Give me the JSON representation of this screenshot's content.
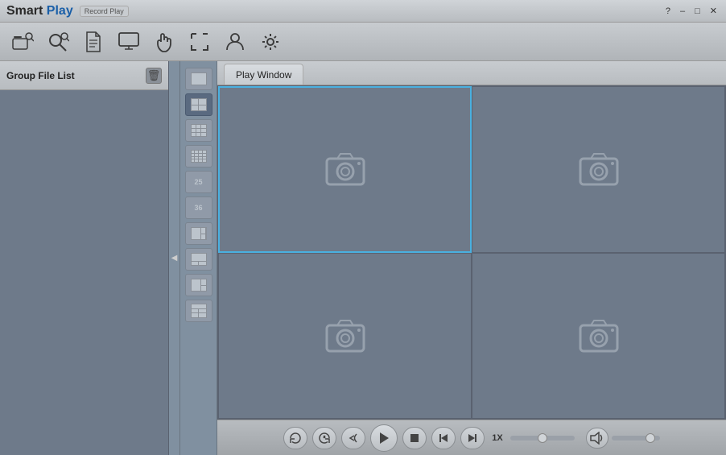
{
  "title_bar": {
    "brand": "Smart",
    "brand_highlight": "Play",
    "subtitle": "Record Play",
    "controls": {
      "help": "?",
      "minimize": "–",
      "maximize": "□",
      "close": "✕"
    }
  },
  "toolbar": {
    "buttons": [
      {
        "name": "open-file-btn",
        "label": "Open File",
        "icon": "folder-add"
      },
      {
        "name": "search-btn",
        "label": "Search",
        "icon": "search"
      },
      {
        "name": "document-btn",
        "label": "Document",
        "icon": "document"
      },
      {
        "name": "monitor-btn",
        "label": "Monitor",
        "icon": "monitor"
      },
      {
        "name": "hand-btn",
        "label": "Pan",
        "icon": "hand"
      },
      {
        "name": "resize-btn",
        "label": "Resize",
        "icon": "resize"
      },
      {
        "name": "user-btn",
        "label": "User",
        "icon": "user"
      },
      {
        "name": "settings-btn",
        "label": "Settings",
        "icon": "gear"
      }
    ]
  },
  "sidebar": {
    "header_label": "Group File List",
    "delete_label": "🗑"
  },
  "layout_buttons": [
    {
      "name": "layout-1",
      "type": "single",
      "active": false
    },
    {
      "name": "layout-4",
      "type": "four",
      "active": true
    },
    {
      "name": "layout-9",
      "type": "nine",
      "active": false
    },
    {
      "name": "layout-16",
      "type": "sixteen",
      "active": false
    },
    {
      "name": "layout-25",
      "type": "twentyfive",
      "active": false,
      "label": "25"
    },
    {
      "name": "layout-36",
      "type": "thirtysix",
      "active": false,
      "label": "36"
    },
    {
      "name": "layout-mixed1",
      "type": "mixed1",
      "active": false
    },
    {
      "name": "layout-mixed2",
      "type": "mixed2",
      "active": false
    },
    {
      "name": "layout-mixed3",
      "type": "mixed3",
      "active": false
    },
    {
      "name": "layout-custom",
      "type": "custom",
      "active": false
    }
  ],
  "play_window": {
    "tab_label": "Play Window",
    "grid_cells": [
      {
        "id": 1,
        "selected": true
      },
      {
        "id": 2,
        "selected": false
      },
      {
        "id": 3,
        "selected": false
      },
      {
        "id": 4,
        "selected": false
      }
    ]
  },
  "controls": {
    "sync_label": "⟳",
    "sync2_label": "⟲",
    "rewind_label": "↩",
    "play_label": "▶",
    "stop_label": "■",
    "prev_frame_label": "◀|",
    "next_frame_label": "|▶",
    "speed_label": "1X",
    "volume_icon": "🔊"
  }
}
